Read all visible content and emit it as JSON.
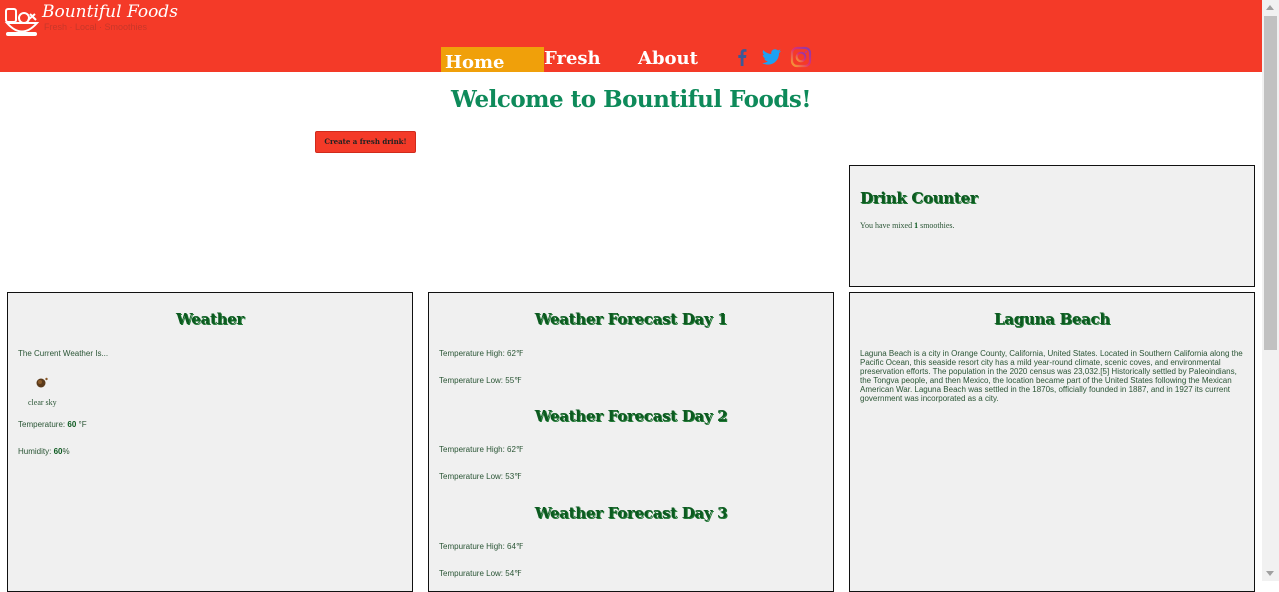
{
  "header": {
    "logo_title": "Bountiful Foods",
    "logo_tagline": "Fresh · Local · Smoothies",
    "nav": [
      {
        "label": "Home",
        "active": true
      },
      {
        "label": "Fresh",
        "active": false
      },
      {
        "label": "About",
        "active": false
      }
    ],
    "social": [
      "facebook-icon",
      "twitter-icon",
      "instagram-icon"
    ]
  },
  "main": {
    "title": "Welcome to Bountiful Foods!",
    "create_button": "Create a fresh drink!"
  },
  "drink_counter": {
    "title": "Drink Counter",
    "text_before": "You have mixed",
    "count": "1",
    "text_after": "smoothies."
  },
  "weather": {
    "title": "Weather",
    "current_label": "The Current Weather Is...",
    "icon": "clear-sky-icon",
    "description": "clear sky",
    "temperature_label": "Temperature:",
    "temperature_value": "60",
    "temperature_unit": "°F",
    "humidity_label": "Humidity:",
    "humidity_value": "60",
    "humidity_unit": "%"
  },
  "forecast": [
    {
      "title": "Weather Forecast Day 1",
      "high": "Temperature High: 62℉",
      "low": "Temperature Low: 55℉"
    },
    {
      "title": "Weather Forecast Day 2",
      "high": "Temperature High: 62℉",
      "low": "Temperature Low: 53℉"
    },
    {
      "title": "Weather Forecast Day 3",
      "high": "Tempurature High: 64℉",
      "low": "Tempurature Low: 54℉"
    }
  ],
  "city": {
    "title": "Laguna Beach",
    "description": "Laguna Beach is a city in Orange County, California, United States. Located in Southern California along the Pacific Ocean, this seaside resort city has a mild year-round climate, scenic coves, and environmental preservation efforts. The population in the 2020 census was 23,032.[5] Historically settled by Paleoindians, the Tongva people, and then Mexico, the location became part of the United States following the Mexican American War. Laguna Beach was settled in the 1870s, officially founded in 1887, and in 1927 its current government was incorporated as a city."
  },
  "colors": {
    "header_bg": "#f43a28",
    "nav_active": "#f0a00a",
    "title_green": "#0e8a5a",
    "heading_green": "#0c5a20",
    "card_bg": "#f0f0f0"
  }
}
